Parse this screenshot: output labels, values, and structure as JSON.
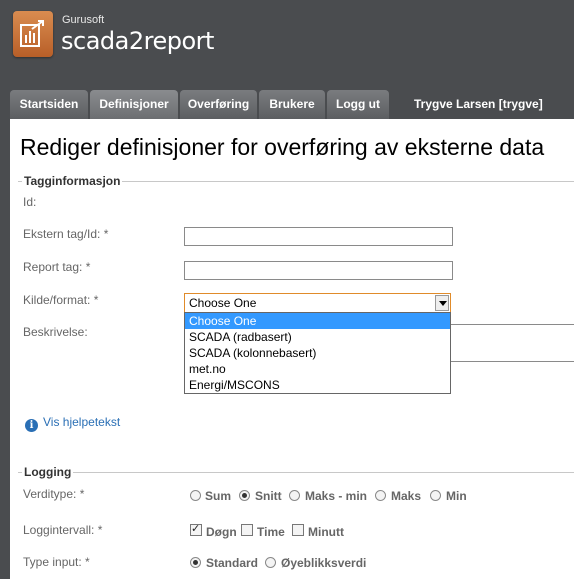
{
  "brand": {
    "company": "Gurusoft",
    "product": "scada2report",
    "icon": "report-chart-icon"
  },
  "tabs": [
    {
      "label": "Startsiden"
    },
    {
      "label": "Definisjoner"
    },
    {
      "label": "Overføring"
    },
    {
      "label": "Brukere"
    },
    {
      "label": "Logg ut"
    }
  ],
  "user": "Trygve Larsen [trygve]",
  "page_title": "Rediger definisjoner for overføring av eksterne data",
  "taginfo": {
    "legend": "Tagginformasjon",
    "id_label": "Id:",
    "ekstern_label": "Ekstern tag/Id: *",
    "ekstern_value": "",
    "report_label": "Report tag: *",
    "report_value": "",
    "kilde_label": "Kilde/format: *",
    "kilde_selected": "Choose One",
    "kilde_options": [
      "Choose One",
      "SCADA (radbasert)",
      "SCADA (kolonnebasert)",
      "met.no",
      "Energi/MSCONS"
    ],
    "beskrivelse_label": "Beskrivelse:",
    "help_text": "Vis hjelpetekst"
  },
  "logging": {
    "legend": "Logging",
    "verditype_label": "Verdityp e: *",
    "verditype_options": [
      "Sum",
      "Snitt",
      "Maks - min",
      "Maks",
      "Min"
    ],
    "verditype_selected": "Snitt",
    "logg_label": "Logginterv all: *",
    "logg_options": [
      "Døgn",
      "Time",
      "Minutt"
    ],
    "logg_checked": [
      "Døgn"
    ],
    "type_label": "Type input: *",
    "type_options": [
      "Standard",
      "Øyeblikksverdi"
    ],
    "type_selected": "Standard"
  }
}
